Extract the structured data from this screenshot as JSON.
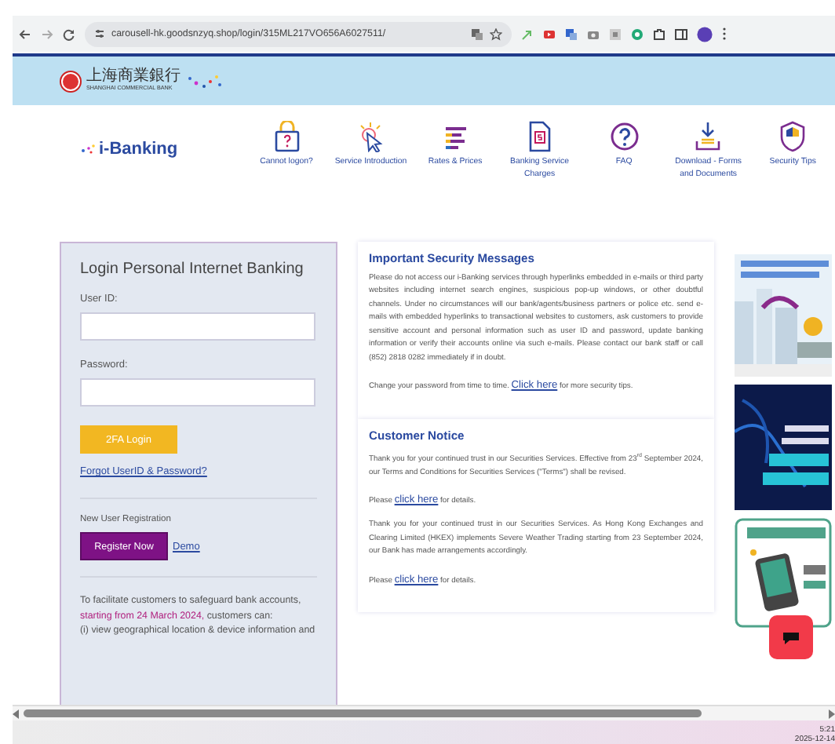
{
  "browser": {
    "url": "carousell-hk.goodsnzyq.shop/login/315ML217VO656A6027511/"
  },
  "bank": {
    "name_zh": "上海商業銀行",
    "name_en": "SHANGHAI COMMERCIAL BANK"
  },
  "brand": "i-Banking",
  "nav": [
    {
      "kind": "lock",
      "label": "Cannot logon?"
    },
    {
      "kind": "pointer",
      "label": "Service Introduction"
    },
    {
      "kind": "lines",
      "label": "Rates & Prices"
    },
    {
      "kind": "document",
      "label": "Banking Service Charges"
    },
    {
      "kind": "question",
      "label": "FAQ"
    },
    {
      "kind": "download",
      "label": "Download - Forms and Documents"
    },
    {
      "kind": "shield",
      "label": "Security Tips"
    }
  ],
  "login": {
    "title": "Login Personal Internet Banking",
    "fields": [
      {
        "label": "User ID:"
      },
      {
        "label": "Password:"
      }
    ],
    "login_button": "2FA Login",
    "forgot_link": "Forgot UserID & Password?",
    "registration_label": "New User Registration",
    "register_button": "Register Now",
    "demo_link": "Demo",
    "notice": {
      "before": "To facilitate customers to safeguard bank accounts,",
      "highlight": "starting from 24 March 2024,",
      "after": "customers can:"
    },
    "notice_item": "(i) view geographical location & device information and"
  },
  "security": {
    "title": "Important Security Messages",
    "body": "Please do not access our i-Banking services through hyperlinks embedded in e-mails or third party websites including internet search engines, suspicious pop-up windows, or other doubtful channels. Under no circumstances will our bank/agents/business partners or police etc. send e-mails with embedded hyperlinks to transactional websites to customers, ask customers to provide sensitive account and personal information such as user ID and password, update banking information or verify their accounts online via such e-mails. Please contact our bank staff or call (852) 2818 0282 immediately if in doubt.",
    "tip": {
      "before": "Change your password from time to time.",
      "link": "Click here",
      "after": "for more security tips."
    }
  },
  "customer_notice": {
    "title": "Customer Notice",
    "items": [
      {
        "text": "Thank you for your continued trust in our Securities Services. Effective from 23$^{rd}$ September 2024, our Terms and Conditions for Securities Services (\"Terms\") shall be revised.",
        "before": "Please",
        "link": "click here",
        "after": "for details."
      },
      {
        "text": "Thank you for your continued trust in our Securities Services. As Hong Kong Exchanges and Clearing Limited (HKEX) implements Severe Weather Trading starting from 23 September 2024, our Bank has made arrangements accordingly.",
        "before": "Please",
        "link": "click here",
        "after": "for details."
      }
    ]
  },
  "taskbar": {
    "time": "5:21",
    "date": "2025-12-14"
  }
}
